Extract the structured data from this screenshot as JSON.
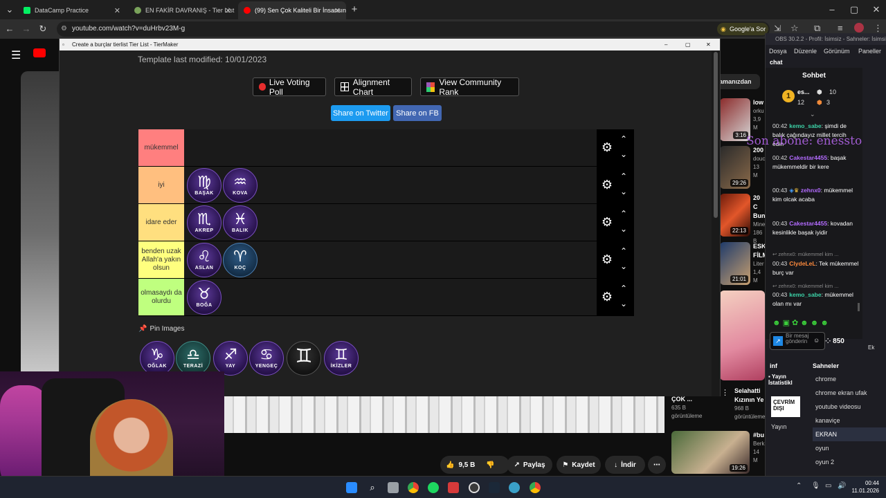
{
  "browser": {
    "tabs": [
      {
        "title": "DataCamp Practice",
        "fav_color": "#03ef62"
      },
      {
        "title": "EN FAKİR DAVRANIŞ - Tier List",
        "fav_color": "#7aa35b"
      },
      {
        "title": "(99) Sen Çok Kaliteli Bir İnsansın",
        "fav_color": "#ff0000"
      }
    ],
    "url": "youtube.com/watch?v=duHrbv23M-g",
    "google_btn": "Google'a Sor"
  },
  "youtube": {
    "sidebar_videos": [
      {
        "title": "low",
        "meta1": "orku",
        "meta2": "3,9 M",
        "duration": "3:16"
      },
      {
        "title": "200",
        "meta1": "douc",
        "meta2": "13 M",
        "duration": "29:26"
      },
      {
        "title": "20 C Bun",
        "meta1": "Mine",
        "meta2": "186 B",
        "duration": "22:13"
      },
      {
        "title": "ESK FİLM",
        "meta1": "Liter",
        "meta2": "1,4 M",
        "duration": "21:01"
      }
    ],
    "chip": "amanızdan",
    "rec_row": [
      {
        "title": "ÇOK ...",
        "meta1": "635 B",
        "meta2": "görüntüleme"
      },
      {
        "title": "Selahatti Kızının Ye",
        "meta1": "968 B",
        "meta2": "görüntüleme"
      }
    ],
    "rec_last": {
      "title": "#bu",
      "meta1": "Berk",
      "meta2": "14 M",
      "duration": "19:26"
    },
    "actions": {
      "likes": "9,5 B",
      "share": "Paylaş",
      "save": "Kaydet",
      "download": "İndir"
    }
  },
  "tiermaker": {
    "window_title": "Create a burçlar tierlist Tier List - TierMaker",
    "template_modified": "Template last modified: 10/01/2023",
    "buttons": {
      "live": "Live Voting Poll",
      "alignment": "Alignment Chart",
      "community": "View Community Rank",
      "twitter": "Share on Twitter",
      "fb": "Share on FB"
    },
    "colors": {
      "twitter": "#1d9bf0",
      "fb": "#4267b2",
      "live_dot": "#e52d2d"
    },
    "tiers": [
      {
        "label": "mükemmel",
        "color": "#ff7f7f",
        "items": []
      },
      {
        "label": "iyi",
        "color": "#ffbf7f",
        "items": [
          {
            "name": "BAŞAK",
            "sym": "♍"
          },
          {
            "name": "KOVA",
            "sym": "♒"
          }
        ]
      },
      {
        "label": "idare eder",
        "color": "#ffdf7f",
        "items": [
          {
            "name": "AKREP",
            "sym": "♏"
          },
          {
            "name": "BALIK",
            "sym": "♓"
          }
        ]
      },
      {
        "label": "benden uzak Allah'a yakın olsun",
        "color": "#ffff7f",
        "items": [
          {
            "name": "ASLAN",
            "sym": "♌"
          },
          {
            "name": "KOÇ",
            "sym": "♈"
          }
        ]
      },
      {
        "label": "olmasaydı da olurdu",
        "color": "#bfff7f",
        "items": [
          {
            "name": "BOĞA",
            "sym": "♉"
          }
        ]
      }
    ],
    "pin_label": "Pin Images",
    "pool": [
      {
        "name": "OĞLAK",
        "sym": "♑"
      },
      {
        "name": "TERAZİ",
        "sym": "♎"
      },
      {
        "name": "YAY",
        "sym": "♐"
      },
      {
        "name": "YENGEÇ",
        "sym": "♋"
      },
      {
        "name": "",
        "sym": "♊"
      },
      {
        "name": "İKİZLER",
        "sym": "♊"
      }
    ]
  },
  "obs": {
    "title": "OBS 30.2.2 - Profil: İsimsiz - Sahneler: İsimsiz",
    "menu": [
      "Dosya",
      "Düzenle",
      "Görünüm",
      "Paneller"
    ],
    "dock_label": "chat",
    "chat_title": "Sohbet",
    "leader": {
      "name": "es...",
      "val1": "10",
      "val2": "12",
      "val3": "3"
    },
    "messages": [
      {
        "time": "00:42",
        "user": "kemo_sabe",
        "color": "#3cd3a8",
        "text": "şimdi de balık çağındayız millet tercih edin"
      },
      {
        "time": "00:42",
        "user": "Cakestar4455",
        "color": "#b36bff",
        "text": "başak mükemmeldir bir kere"
      },
      {
        "time": "00:43",
        "user": "zehnx0",
        "color": "#b36bff",
        "text": "mükemmel kim olcak acaba"
      },
      {
        "time": "00:43",
        "user": "Cakestar4455",
        "color": "#b36bff",
        "text": "kovadan kesinlikle başak iyidir"
      },
      {
        "reply": "zehnx0: mükemmel kim ...",
        "time": "00:43",
        "user": "ClydeLeL",
        "color": "#ff8a3d",
        "text": "Tek mükemmel burç var"
      },
      {
        "reply": "zehnx0: mükemmel kim ...",
        "time": "00:43",
        "user": "kemo_sabe",
        "color": "#3cd3a8",
        "text": "mükemmel olan mı var"
      }
    ],
    "overlay_text": "Son abone: enessto",
    "send_placeholder": "Bir mesaj gönderin",
    "points": "850",
    "ek": "Ek",
    "inf_label": "inf",
    "stats_label": "Yayın İstatistikl",
    "offline": "ÇEVRİM DIŞI",
    "stream_label": "Yayın",
    "scenes_label": "Sahneler",
    "scenes": [
      "chrome",
      "chrome ekran ufak",
      "youtube videosu",
      "kanaviçe",
      "EKRAN",
      "oyun",
      "oyun 2"
    ],
    "selected_scene": "EKRAN"
  },
  "taskbar": {
    "time": "00:44",
    "date": "11.01.2026"
  }
}
